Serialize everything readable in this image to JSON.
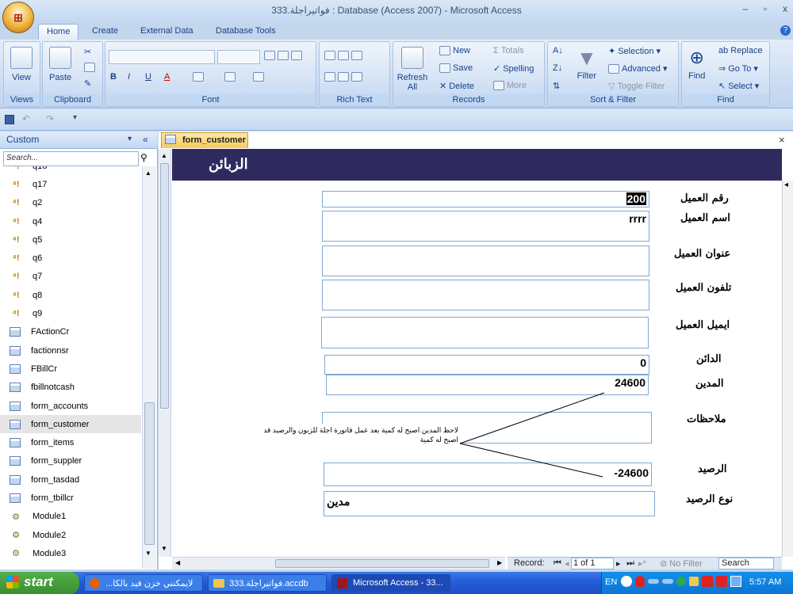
{
  "window": {
    "title": "333.فواتيراجلة : Database (Access 2007) - Microsoft Access",
    "controls": {
      "minimize": "–",
      "restore": "▫",
      "close": "x"
    }
  },
  "ribbon_tabs": [
    "Home",
    "Create",
    "External Data",
    "Database Tools"
  ],
  "ribbon": {
    "views": {
      "view": "View",
      "label": "Views"
    },
    "clipboard": {
      "paste": "Paste",
      "label": "Clipboard"
    },
    "font": {
      "label": "Font"
    },
    "rich_text": {
      "label": "Rich Text"
    },
    "records": {
      "refresh": "Refresh All",
      "new": "New",
      "save": "Save",
      "delete": "Delete",
      "totals": "Totals",
      "spelling": "Spelling",
      "more": "More",
      "label": "Records"
    },
    "sort_filter": {
      "filter": "Filter",
      "selection": "Selection",
      "advanced": "Advanced",
      "toggle": "Toggle Filter",
      "label": "Sort & Filter"
    },
    "find": {
      "find": "Find",
      "replace": "Replace",
      "goto": "Go To",
      "select": "Select",
      "label": "Find"
    }
  },
  "nav": {
    "header": "Custom",
    "search_placeholder": "Search...",
    "items": [
      {
        "label": "q16",
        "type": "query"
      },
      {
        "label": "q17",
        "type": "query"
      },
      {
        "label": "q2",
        "type": "query"
      },
      {
        "label": "q4",
        "type": "query"
      },
      {
        "label": "q5",
        "type": "query"
      },
      {
        "label": "q6",
        "type": "query"
      },
      {
        "label": "q7",
        "type": "query"
      },
      {
        "label": "q8",
        "type": "query"
      },
      {
        "label": "q9",
        "type": "query"
      },
      {
        "label": "FActionCr",
        "type": "form"
      },
      {
        "label": "factionnsr",
        "type": "form"
      },
      {
        "label": "FBillCr",
        "type": "form"
      },
      {
        "label": "fbillnotcash",
        "type": "form"
      },
      {
        "label": "form_accounts",
        "type": "form"
      },
      {
        "label": "form_customer",
        "type": "form",
        "selected": true
      },
      {
        "label": "form_items",
        "type": "form"
      },
      {
        "label": "form_suppler",
        "type": "form"
      },
      {
        "label": "form_tasdad",
        "type": "form"
      },
      {
        "label": "form_tbillcr",
        "type": "form"
      },
      {
        "label": "Module1",
        "type": "module"
      },
      {
        "label": "Module2",
        "type": "module"
      },
      {
        "label": "Module3",
        "type": "module"
      }
    ]
  },
  "form": {
    "tab_label": "form_customer",
    "header_title": "الزبائن",
    "fields": {
      "customer_id": {
        "label": "رقم العميل",
        "value": "200"
      },
      "customer_name": {
        "label": "اسم العميل",
        "value": "rrrr"
      },
      "customer_address": {
        "label": "عنوان العميل",
        "value": ""
      },
      "customer_phone": {
        "label": "تلفون العميل",
        "value": ""
      },
      "customer_email": {
        "label": "ايميل العميل",
        "value": ""
      },
      "creditor": {
        "label": "الدائن",
        "value": "0"
      },
      "debtor": {
        "label": "المدين",
        "value": "24600"
      },
      "notes": {
        "label": "ملاحظات",
        "value": ""
      },
      "balance": {
        "label": "الرصيد",
        "value": "-24600"
      },
      "balance_type": {
        "label": "نوع الرصيد",
        "value": "مدين"
      }
    },
    "annotation": "لاحظ المدين اصبح له كمية بعد عمل فاتورة اجلة للزبون والرصيد قد اصبح له كمية"
  },
  "record_nav": {
    "label": "Record:",
    "position": "1 of 1",
    "filter": "No Filter",
    "search": "Search"
  },
  "taskbar": {
    "start": "start",
    "tasks": [
      "...لايمكنني خزن فيد بالكا",
      "333.فواتيراجلة.accdb",
      "Microsoft Access - 33..."
    ],
    "lang": "EN",
    "clock": "5:57 AM"
  }
}
